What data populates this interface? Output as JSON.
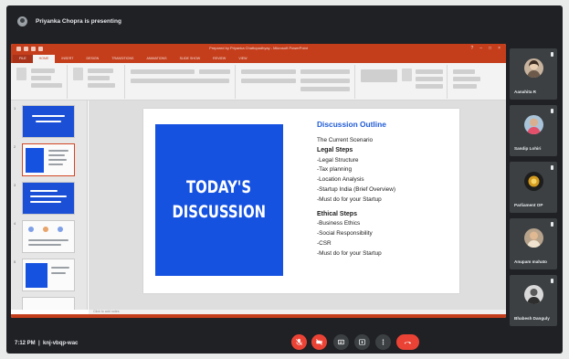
{
  "presenting": {
    "text": "Priyanka Chopra is presenting"
  },
  "ppt": {
    "window_title": "Prepared by Priyanka Chattopadhyay - Microsoft PowerPoint",
    "tabs": [
      "FILE",
      "HOME",
      "INSERT",
      "DESIGN",
      "TRANSITIONS",
      "ANIMATIONS",
      "SLIDE SHOW",
      "REVIEW",
      "VIEW"
    ],
    "active_tab": "HOME",
    "notes_placeholder": "Click to add notes",
    "accent": "#c43e1c"
  },
  "slide": {
    "left_heading_line1": "TODAY'S",
    "left_heading_line2": "DISCUSSION",
    "outline_title": "Discussion Outline",
    "outline": [
      {
        "text": "The Current Scenario",
        "bold": false
      },
      {
        "text": "Legal Steps",
        "bold": true
      },
      {
        "text": "-Legal Structure",
        "bold": false
      },
      {
        "text": "-Tax planning",
        "bold": false
      },
      {
        "text": "-Location Analysis",
        "bold": false
      },
      {
        "text": "-Startup India (Brief Overview)",
        "bold": false
      },
      {
        "text": "-Must do for your Startup",
        "bold": false
      },
      {
        "text": "",
        "bold": false
      },
      {
        "text": "Ethical Steps",
        "bold": true
      },
      {
        "text": "-Business Ethics",
        "bold": false
      },
      {
        "text": "-Social Responsibility",
        "bold": false
      },
      {
        "text": "-CSR",
        "bold": false
      },
      {
        "text": "-Must do for your Startup",
        "bold": false
      }
    ],
    "blue": "#1652e0"
  },
  "participants": [
    {
      "name": "Aanahita R"
    },
    {
      "name": "Sandip Lohiri"
    },
    {
      "name": "Parliament OP"
    },
    {
      "name": "Anupam mahato"
    },
    {
      "name": "Bhabesh Danguly"
    }
  ],
  "footer": {
    "time": "7:12 PM",
    "meeting_code": "knj-vbqp-wac"
  }
}
